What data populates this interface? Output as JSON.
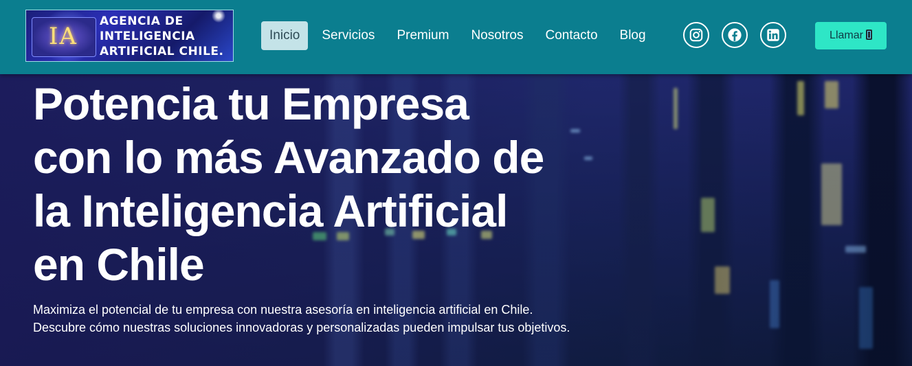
{
  "header": {
    "logo": {
      "monogram": "IA",
      "lines": [
        "AGENCIA DE",
        "INTELIGENCIA",
        "ARTIFICIAL CHILE."
      ]
    },
    "nav": [
      {
        "label": "Inicio",
        "active": true
      },
      {
        "label": "Servicios",
        "active": false
      },
      {
        "label": "Premium",
        "active": false
      },
      {
        "label": "Nosotros",
        "active": false
      },
      {
        "label": "Contacto",
        "active": false
      },
      {
        "label": "Blog",
        "active": false
      }
    ],
    "social": [
      "instagram-icon",
      "facebook-icon",
      "linkedin-icon"
    ],
    "call_label": "Llamar",
    "colors": {
      "bar": "#0b7e8f",
      "active_nav": "#c4e3e8",
      "call_button": "#2ee6c6"
    }
  },
  "hero": {
    "title": "Potencia tu Empresa con lo más Avanzado de la Inteligencia Artificial en Chile",
    "subtitle": "Maximiza el potencial de tu empresa con nuestra asesoría en inteligencia artificial en Chile. Descubre cómo nuestras soluciones innovadoras y personalizadas pueden impulsar tus objetivos."
  }
}
